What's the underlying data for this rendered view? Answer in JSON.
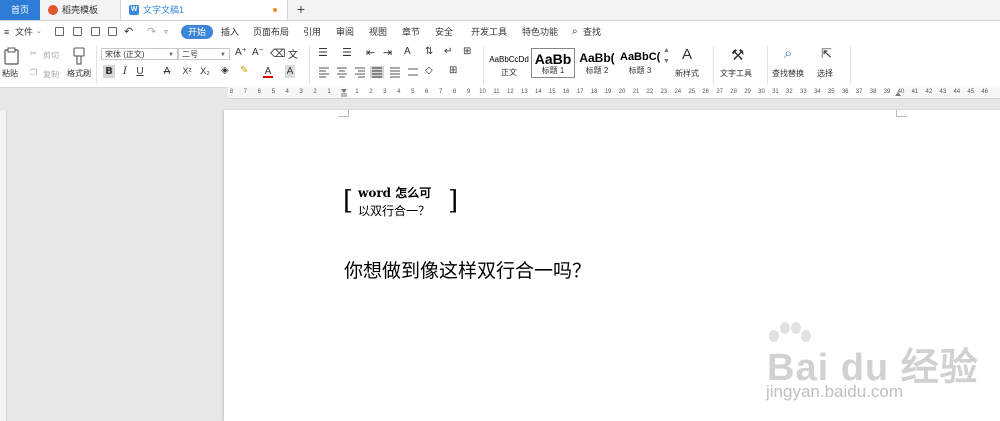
{
  "tabs": {
    "home": "首页",
    "template": "稻壳模板",
    "document": "文字文稿1",
    "doc_icon": "W",
    "new_tab": "+"
  },
  "menu": {
    "file": "文件",
    "items": [
      "开始",
      "插入",
      "页面布局",
      "引用",
      "审阅",
      "视图",
      "章节",
      "安全",
      "开发工具",
      "特色功能"
    ],
    "search": "查找"
  },
  "ribbon": {
    "paste": "粘贴",
    "cut": "剪切",
    "copy": "复制",
    "format_painter": "格式刷",
    "font_name": "宋体 (正文)",
    "font_size": "二号",
    "bold": "B",
    "italic": "I",
    "underline": "U",
    "strike": "A",
    "superscript": "X²",
    "subscript": "X₂",
    "font_color": "A",
    "char_shade": "A",
    "grow_font": "A⁺",
    "shrink_font": "A⁻",
    "styles": [
      {
        "preview": "AaBbCcDd",
        "label": "正文"
      },
      {
        "preview": "AaBb",
        "label": "标题 1"
      },
      {
        "preview": "AaBb(",
        "label": "标题 2"
      },
      {
        "preview": "AaBbC(",
        "label": "标题 3"
      }
    ],
    "new_style": "新样式",
    "text_tools": "文字工具",
    "find_replace": "查找替换",
    "select": "选择"
  },
  "ruler": {
    "numbers": [
      8,
      7,
      6,
      5,
      4,
      3,
      2,
      1,
      1,
      2,
      3,
      4,
      5,
      6,
      7,
      8,
      9,
      10,
      11,
      12,
      13,
      14,
      15,
      16,
      17,
      18,
      19,
      20,
      21,
      22,
      23,
      24,
      25,
      26,
      27,
      28,
      29,
      30,
      31,
      32,
      33,
      34,
      35,
      36,
      37,
      38,
      39,
      40,
      41,
      42,
      43,
      44,
      45,
      46
    ]
  },
  "document": {
    "two_line_1": "word 怎么可",
    "two_line_2": "以双行合一？",
    "bracket_left": "[",
    "bracket_right": "]",
    "body": "你想做到像这样双行合一吗？"
  },
  "watermark": {
    "brand": "Bai du 经验",
    "url": "jingyan.baidu.com"
  }
}
